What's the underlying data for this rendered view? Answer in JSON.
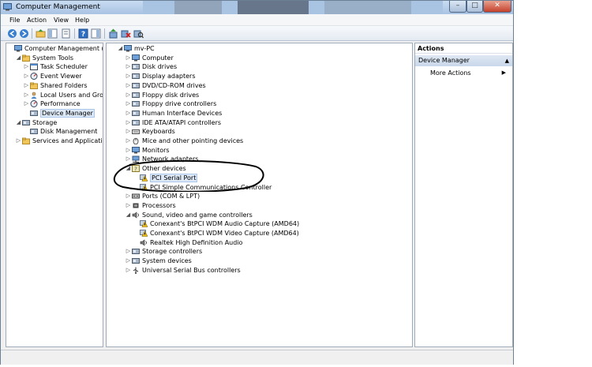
{
  "window": {
    "title": "Computer Management"
  },
  "menu": [
    "File",
    "Action",
    "View",
    "Help"
  ],
  "tree_left": [
    {
      "label": "Computer Management (Local",
      "indent": 0,
      "twisty": "",
      "icon": "computer-management-icon"
    },
    {
      "label": "System Tools",
      "indent": 1,
      "twisty": "◢",
      "icon": "system-tools-icon"
    },
    {
      "label": "Task Scheduler",
      "indent": 2,
      "twisty": "▷",
      "icon": "task-scheduler-icon"
    },
    {
      "label": "Event Viewer",
      "indent": 2,
      "twisty": "▷",
      "icon": "event-viewer-icon"
    },
    {
      "label": "Shared Folders",
      "indent": 2,
      "twisty": "▷",
      "icon": "shared-folders-icon"
    },
    {
      "label": "Local Users and Groups",
      "indent": 2,
      "twisty": "▷",
      "icon": "local-users-icon"
    },
    {
      "label": "Performance",
      "indent": 2,
      "twisty": "▷",
      "icon": "performance-icon"
    },
    {
      "label": "Device Manager",
      "indent": 2,
      "twisty": "",
      "icon": "device-manager-icon",
      "selected": true
    },
    {
      "label": "Storage",
      "indent": 1,
      "twisty": "◢",
      "icon": "storage-icon"
    },
    {
      "label": "Disk Management",
      "indent": 2,
      "twisty": "",
      "icon": "disk-management-icon"
    },
    {
      "label": "Services and Applications",
      "indent": 1,
      "twisty": "▷",
      "icon": "services-icon"
    }
  ],
  "tree_main": [
    {
      "label": "mv-PC",
      "indent": 0,
      "twisty": "◢",
      "icon": "computer-icon"
    },
    {
      "label": "Computer",
      "indent": 1,
      "twisty": "▷",
      "icon": "computer-icon"
    },
    {
      "label": "Disk drives",
      "indent": 1,
      "twisty": "▷",
      "icon": "disk-drive-icon"
    },
    {
      "label": "Display adapters",
      "indent": 1,
      "twisty": "▷",
      "icon": "display-adapter-icon"
    },
    {
      "label": "DVD/CD-ROM drives",
      "indent": 1,
      "twisty": "▷",
      "icon": "dvd-drive-icon"
    },
    {
      "label": "Floppy disk drives",
      "indent": 1,
      "twisty": "▷",
      "icon": "floppy-icon"
    },
    {
      "label": "Floppy drive controllers",
      "indent": 1,
      "twisty": "▷",
      "icon": "floppy-controller-icon"
    },
    {
      "label": "Human Interface Devices",
      "indent": 1,
      "twisty": "▷",
      "icon": "hid-icon"
    },
    {
      "label": "IDE ATA/ATAPI controllers",
      "indent": 1,
      "twisty": "▷",
      "icon": "ide-controller-icon"
    },
    {
      "label": "Keyboards",
      "indent": 1,
      "twisty": "▷",
      "icon": "keyboard-icon"
    },
    {
      "label": "Mice and other pointing devices",
      "indent": 1,
      "twisty": "▷",
      "icon": "mouse-icon"
    },
    {
      "label": "Monitors",
      "indent": 1,
      "twisty": "▷",
      "icon": "monitor-icon"
    },
    {
      "label": "Network adapters",
      "indent": 1,
      "twisty": "▷",
      "icon": "network-adapter-icon"
    },
    {
      "label": "Other devices",
      "indent": 1,
      "twisty": "◢",
      "icon": "other-devices-icon"
    },
    {
      "label": "PCI Serial Port",
      "indent": 2,
      "twisty": "",
      "icon": "warning-device-icon",
      "selected": true
    },
    {
      "label": "PCI Simple Communications Controller",
      "indent": 2,
      "twisty": "",
      "icon": "warning-device-icon"
    },
    {
      "label": "Ports (COM & LPT)",
      "indent": 1,
      "twisty": "▷",
      "icon": "ports-icon"
    },
    {
      "label": "Processors",
      "indent": 1,
      "twisty": "▷",
      "icon": "processor-icon"
    },
    {
      "label": "Sound, video and game controllers",
      "indent": 1,
      "twisty": "◢",
      "icon": "sound-icon"
    },
    {
      "label": "Conexant's BtPCI WDM Audio Capture (AMD64)",
      "indent": 2,
      "twisty": "",
      "icon": "warning-sound-icon"
    },
    {
      "label": "Conexant's BtPCI WDM Video Capture (AMD64)",
      "indent": 2,
      "twisty": "",
      "icon": "warning-sound-icon"
    },
    {
      "label": "Realtek High Definition Audio",
      "indent": 2,
      "twisty": "",
      "icon": "speaker-icon"
    },
    {
      "label": "Storage controllers",
      "indent": 1,
      "twisty": "▷",
      "icon": "storage-controller-icon"
    },
    {
      "label": "System devices",
      "indent": 1,
      "twisty": "▷",
      "icon": "system-devices-icon"
    },
    {
      "label": "Universal Serial Bus controllers",
      "indent": 1,
      "twisty": "▷",
      "icon": "usb-icon"
    }
  ],
  "actions": {
    "title": "Actions",
    "section": "Device Manager",
    "more": "More Actions"
  },
  "colors": {
    "selection": "#dde9f7",
    "warning": "#f5c518",
    "close": "#c4412b"
  }
}
